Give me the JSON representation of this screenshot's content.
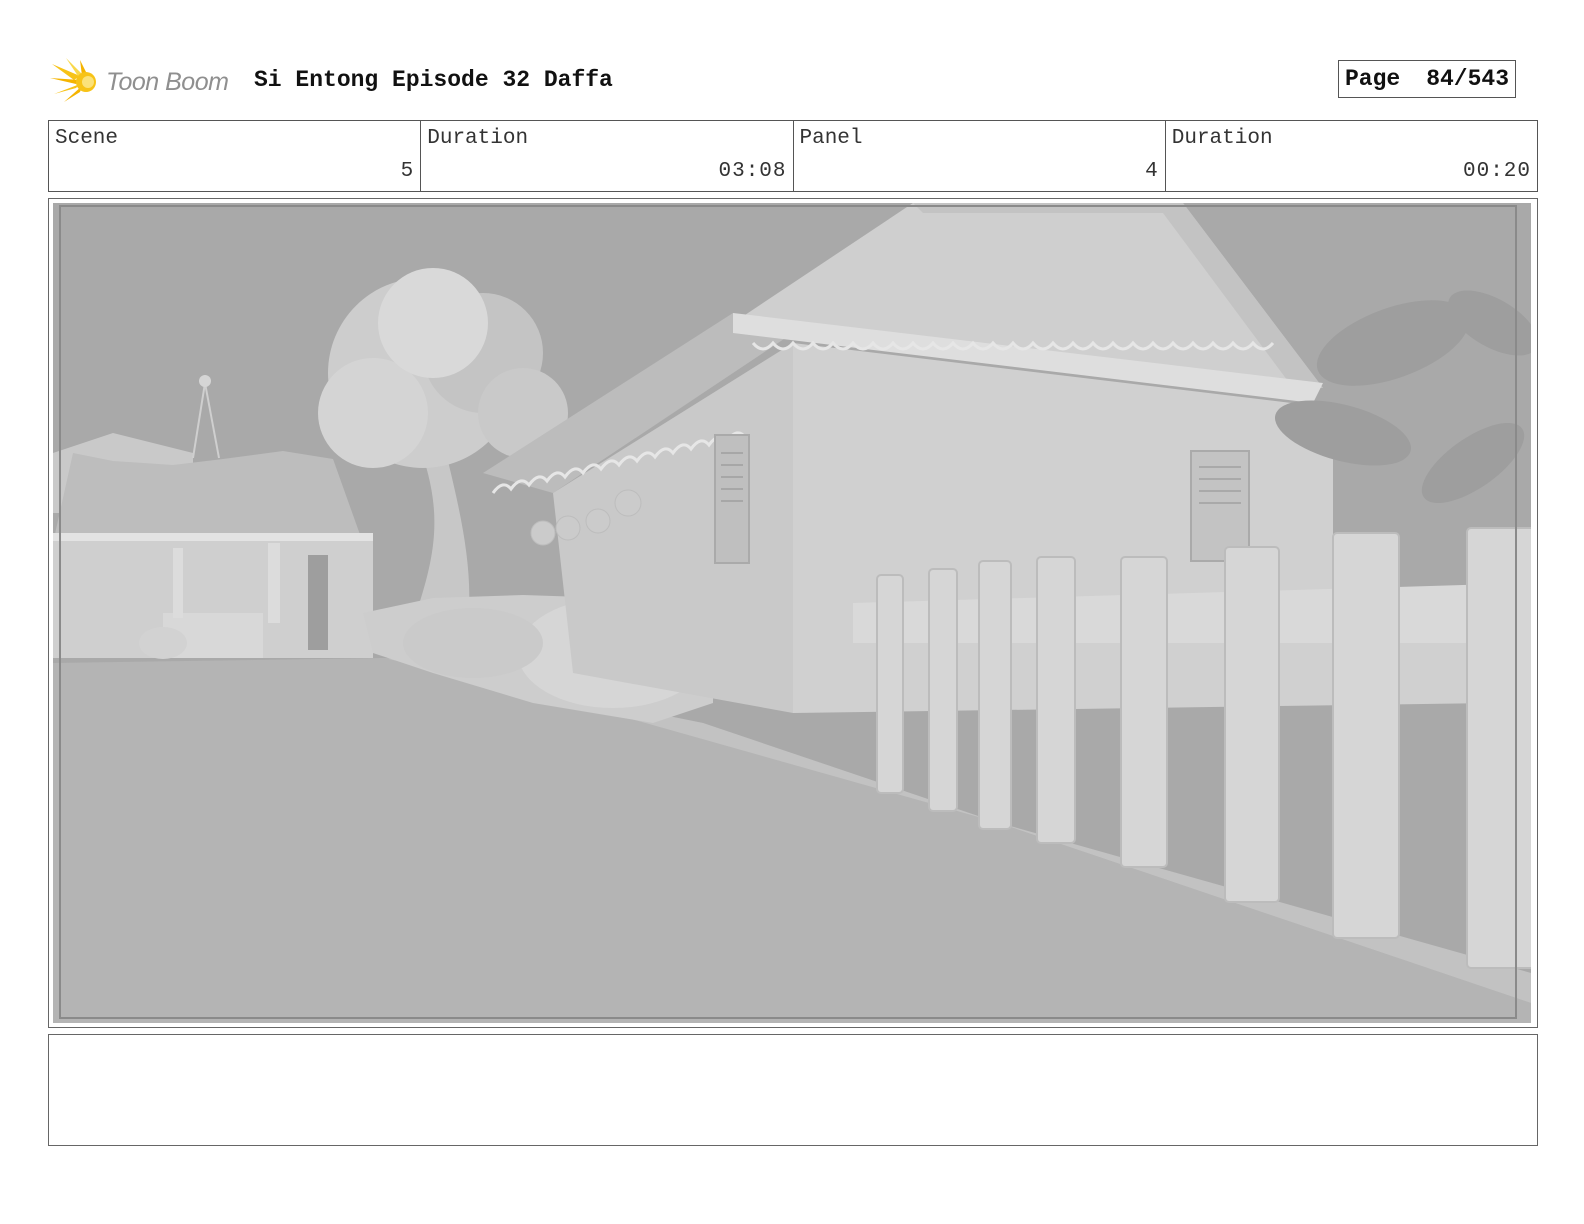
{
  "header": {
    "logo_text": "Toon Boom",
    "project_title": "Si Entong Episode 32 Daffa",
    "page_label": "Page",
    "page_number": "84/543"
  },
  "info": {
    "scene_label": "Scene",
    "scene_value": "5",
    "scene_duration_label": "Duration",
    "scene_duration_value": "03:08",
    "panel_label": "Panel",
    "panel_value": "4",
    "panel_duration_label": "Duration",
    "panel_duration_value": "00:20"
  },
  "panel": {
    "image_content": "grey 3D render of a village street with a house, tree and wooden fence"
  },
  "colors": {
    "logo_yellow": "#f7c317",
    "logo_grey": "#8f8f8f",
    "border": "#555555"
  }
}
